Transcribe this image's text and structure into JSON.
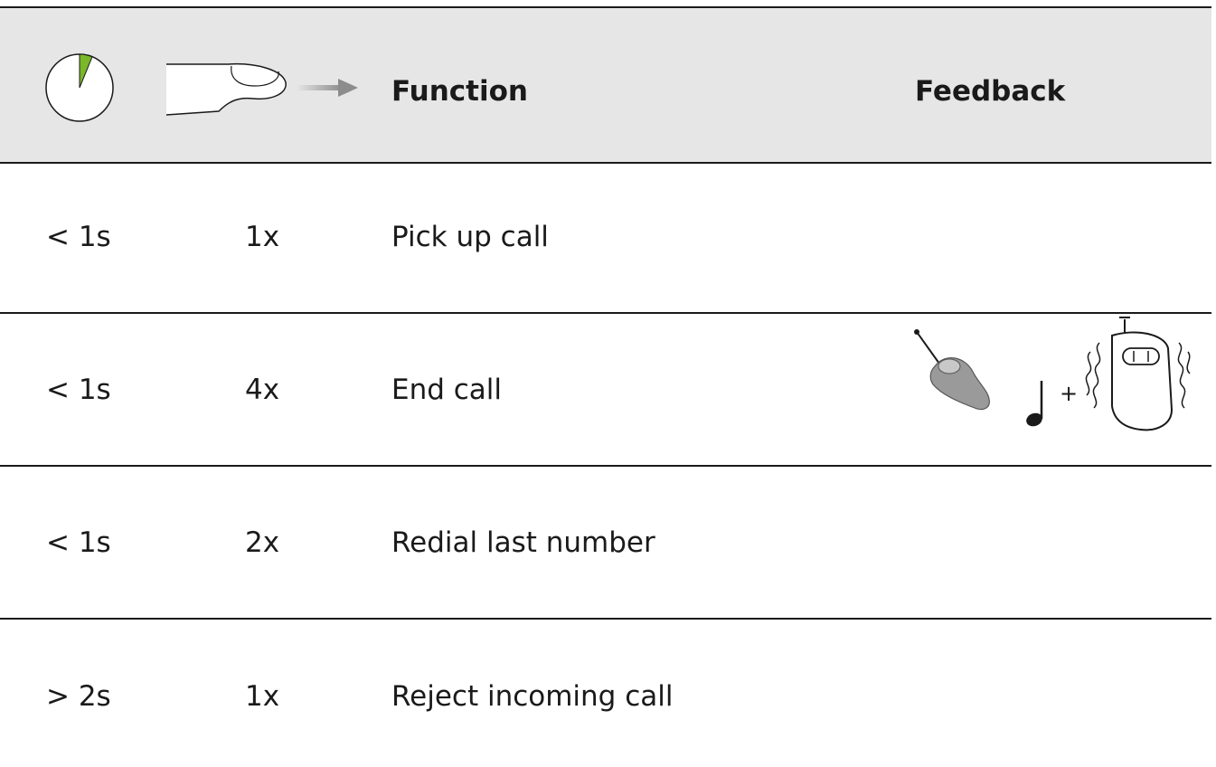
{
  "header": {
    "duration_icon": "timer-icon",
    "press_icon": "finger-press-icon",
    "function_label": "Function",
    "feedback_label": "Feedback"
  },
  "rows": [
    {
      "duration": "< 1s",
      "presses": "1x",
      "function": "Pick up call",
      "feedback": ""
    },
    {
      "duration": "< 1s",
      "presses": "4x",
      "function": "End call",
      "feedback": "+"
    },
    {
      "duration": "< 1s",
      "presses": "2x",
      "function": "Redial last number",
      "feedback": ""
    },
    {
      "duration": "> 2s",
      "presses": "1x",
      "function": "Reject incoming call",
      "feedback": ""
    }
  ],
  "colors": {
    "header_bg": "#e6e6e6",
    "timer_accent": "#7ab829",
    "rule": "#1a1a1a"
  }
}
